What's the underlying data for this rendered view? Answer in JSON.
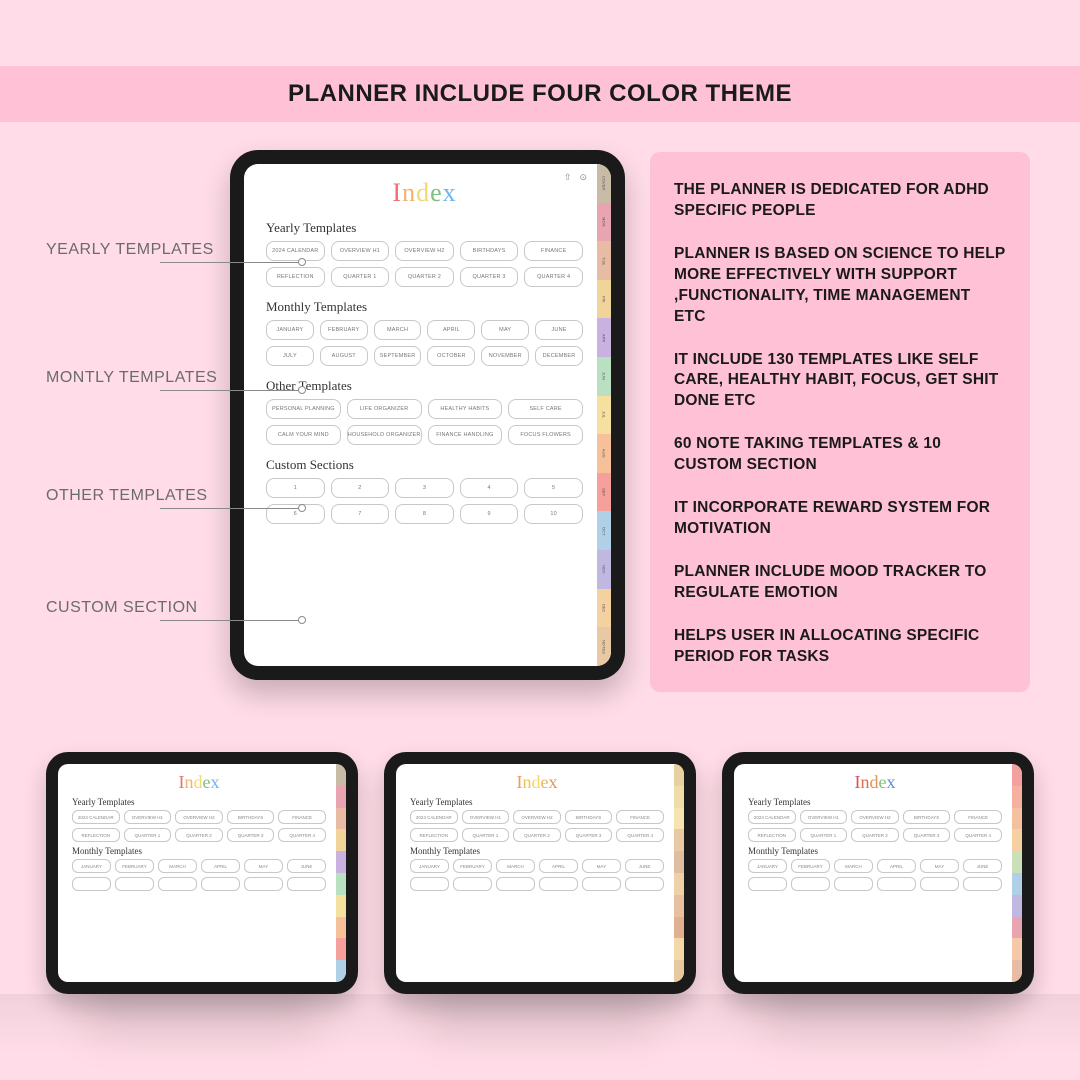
{
  "header": {
    "title": "PLANNER INCLUDE FOUR COLOR THEME"
  },
  "ipad": {
    "title_chars": [
      "I",
      "n",
      "d",
      "e",
      "x"
    ],
    "sections": {
      "yearly": {
        "label": "Yearly Templates",
        "row1": [
          "2024 CALENDAR",
          "OVERVIEW H1",
          "OVERVIEW H2",
          "BIRTHDAYS",
          "FINANCE"
        ],
        "row2": [
          "REFLECTION",
          "QUARTER 1",
          "QUARTER 2",
          "QUARTER 3",
          "QUARTER 4"
        ]
      },
      "monthly": {
        "label": "Monthly Templates",
        "row1": [
          "JANUARY",
          "FEBRUARY",
          "MARCH",
          "APRIL",
          "MAY",
          "JUNE"
        ],
        "row2": [
          "JULY",
          "AUGUST",
          "SEPTEMBER",
          "OCTOBER",
          "NOVEMBER",
          "DECEMBER"
        ]
      },
      "other": {
        "label": "Other Templates",
        "row1": [
          "PERSONAL PLANNING",
          "LIFE ORGANIZER",
          "HEALTHY HABITS",
          "SELF CARE"
        ],
        "row2": [
          "CALM YOUR MIND",
          "HOUSEHOLD ORGANIZER",
          "FINANCE HANDLING",
          "FOCUS FLOWERS"
        ]
      },
      "custom": {
        "label": "Custom Sections",
        "row1": [
          "1",
          "2",
          "3",
          "4",
          "5"
        ],
        "row2": [
          "6",
          "7",
          "8",
          "9",
          "10"
        ]
      }
    },
    "tabs": [
      "COVER",
      "MON",
      "TUE",
      "FRI",
      "APR",
      "JUN",
      "JUL",
      "AUG",
      "SEP",
      "OCT",
      "NOV",
      "DEC",
      "NOTES"
    ],
    "tab_colors": [
      "#c8bca7",
      "#e8a4b0",
      "#e8bca4",
      "#f0d49a",
      "#c9b2e0",
      "#b8e0c1",
      "#f5e0a0",
      "#f5c09a",
      "#f5a09a",
      "#b0d0e8",
      "#c0b8e0",
      "#f5d0a0",
      "#e8c9a4"
    ]
  },
  "callouts": {
    "yearly": "YEARLY TEMPLATES",
    "monthly": "MONTLY TEMPLATES",
    "other": "OTHER TEMPLATES",
    "custom": "CUSTOM SECTION"
  },
  "features": [
    "THE PLANNER IS DEDICATED FOR ADHD SPECIFIC PEOPLE",
    "PLANNER IS BASED ON SCIENCE TO HELP MORE EFFECTIVELY WITH SUPPORT ,FUNCTIONALITY, TIME MANAGEMENT ETC",
    "IT INCLUDE 130 TEMPLATES LIKE SELF CARE, HEALTHY HABIT, FOCUS, GET SHIT DONE ETC",
    "60 NOTE TAKING TEMPLATES & 10 CUSTOM SECTION",
    "IT INCORPORATE REWARD SYSTEM FOR MOTIVATION",
    "PLANNER INCLUDE MOOD TRACKER TO REGULATE EMOTION",
    "HELPS USER IN ALLOCATING SPECIFIC PERIOD FOR TASKS"
  ],
  "small_tabs_colors": [
    [
      "#c8bca7",
      "#e8a4b0",
      "#e8bca4",
      "#f0d49a",
      "#c9b2e0",
      "#b8e0c1",
      "#f5e0a0",
      "#f5c09a",
      "#f5a09a",
      "#b0d0e8"
    ],
    [
      "#e8d0a0",
      "#f0dca8",
      "#f5e4b0",
      "#e8c9a4",
      "#e0bca0",
      "#f0d0a8",
      "#e8c0a0",
      "#e0b090",
      "#f5d8a8",
      "#e8c8a0"
    ],
    [
      "#f5a0a0",
      "#f5b0a0",
      "#f5c0a0",
      "#f5d0a0",
      "#c9e0b8",
      "#b0d0e8",
      "#c0b8e0",
      "#e8a4b0",
      "#f5c8a8",
      "#e8bca4"
    ]
  ]
}
